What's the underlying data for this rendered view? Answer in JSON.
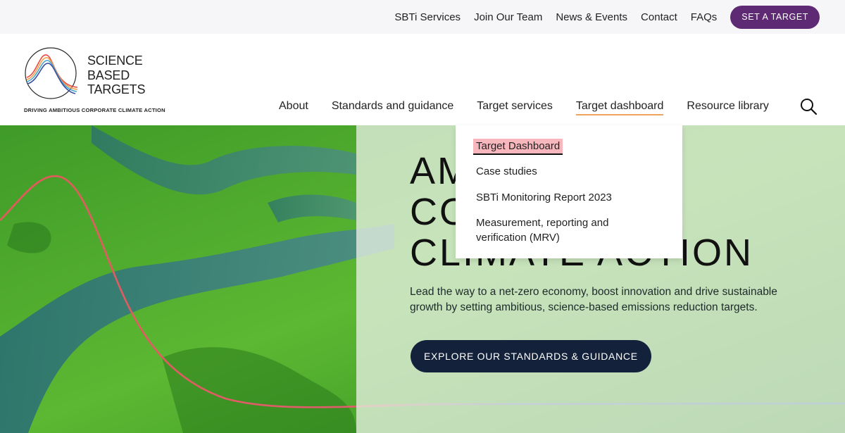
{
  "topbar": {
    "links": [
      "SBTi Services",
      "Join Our Team",
      "News & Events",
      "Contact",
      "FAQs"
    ],
    "cta": "SET A TARGET"
  },
  "logo": {
    "lines": [
      "SCIENCE",
      "BASED",
      "TARGETS"
    ],
    "tagline": "DRIVING AMBITIOUS CORPORATE CLIMATE ACTION"
  },
  "nav": {
    "items": [
      "About",
      "Standards and guidance",
      "Target services",
      "Target dashboard",
      "Resource library"
    ],
    "active_index": 3
  },
  "dropdown": {
    "items": [
      "Target Dashboard",
      "Case studies",
      "SBTi Monitoring Report 2023",
      "Measurement, reporting and verification (MRV)"
    ]
  },
  "hero": {
    "title_lines": [
      "AMBITIOUS",
      "CORPORATE",
      "CLIMATE ACTION"
    ],
    "description": "Lead the way to a net-zero economy, boost innovation and drive sustainable growth by setting ambitious, science-based emissions reduction targets.",
    "button": "EXPLORE OUR STANDARDS & GUIDANCE"
  },
  "colors": {
    "accent_purple": "#5e2a73",
    "nav_underline": "#f0a35e",
    "highlight": "#f7b7bd",
    "button_dark": "#13213a"
  }
}
